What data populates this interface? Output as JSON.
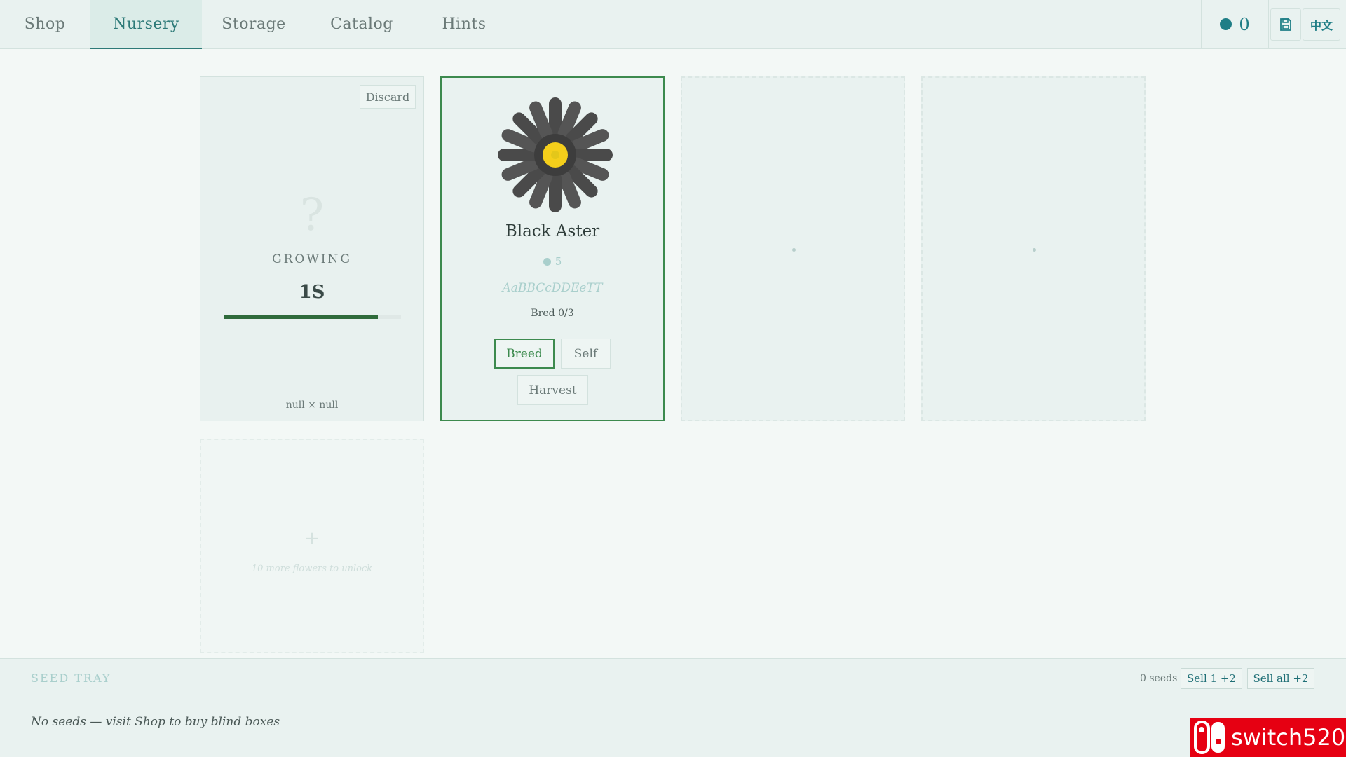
{
  "nav": {
    "tabs": [
      {
        "label": "Shop"
      },
      {
        "label": "Nursery"
      },
      {
        "label": "Storage"
      },
      {
        "label": "Catalog"
      },
      {
        "label": "Hints"
      }
    ],
    "active_tab": "Nursery",
    "coins": "0",
    "language_label": "中文"
  },
  "plots": {
    "growing": {
      "discard_label": "Discard",
      "question_mark": "?",
      "status_label": "GROWING",
      "time_left": "1S",
      "progress": 0.87,
      "parents": "null × null"
    },
    "flower": {
      "name": "Black Aster",
      "value": "5",
      "genes": "AaBBCcDDEeTT",
      "bred": "Bred 0/3",
      "breed_label": "Breed",
      "self_label": "Self",
      "harvest_label": "Harvest",
      "petal_color": "#4a4a4a",
      "center_color": "#f5cf1b"
    },
    "locked": {
      "plus": "+",
      "unlock_text": "10 more flowers to unlock"
    }
  },
  "seed_tray": {
    "title": "SEED TRAY",
    "count": "0 seeds",
    "sell_one_label": "Sell 1 +2",
    "sell_all_label": "Sell all +2",
    "empty_text": "No seeds — visit Shop to buy blind boxes"
  },
  "watermark": {
    "text": "switch520"
  },
  "colors": {
    "accent": "#2d7a78",
    "green": "#3c8a4e",
    "coin": "#1f7e86"
  }
}
